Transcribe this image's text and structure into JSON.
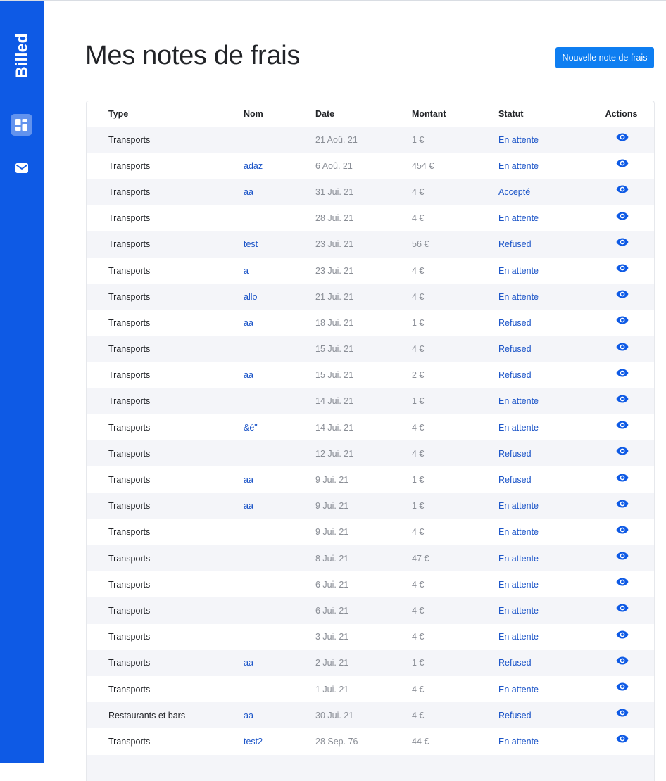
{
  "app": {
    "logo": "Billed"
  },
  "header": {
    "title": "Mes notes de frais",
    "new_button": "Nouvelle note de frais"
  },
  "colors": {
    "sidebar": "#0e5ae5",
    "button": "#0e7ef1",
    "link": "#1c55c8"
  },
  "table": {
    "columns": [
      "Type",
      "Nom",
      "Date",
      "Montant",
      "Statut",
      "Actions"
    ],
    "rows": [
      {
        "type": "Transports",
        "nom": "",
        "date": "21 Aoû. 21",
        "amount": "1 €",
        "status": "En attente"
      },
      {
        "type": "Transports",
        "nom": "adaz",
        "date": "6 Aoû. 21",
        "amount": "454 €",
        "status": "En attente"
      },
      {
        "type": "Transports",
        "nom": "aa",
        "date": "31 Jui. 21",
        "amount": "4 €",
        "status": "Accepté"
      },
      {
        "type": "Transports",
        "nom": "",
        "date": "28 Jui. 21",
        "amount": "4 €",
        "status": "En attente"
      },
      {
        "type": "Transports",
        "nom": "test",
        "date": "23 Jui. 21",
        "amount": "56 €",
        "status": "Refused"
      },
      {
        "type": "Transports",
        "nom": "a",
        "date": "23 Jui. 21",
        "amount": "4 €",
        "status": "En attente"
      },
      {
        "type": "Transports",
        "nom": "allo",
        "date": "21 Jui. 21",
        "amount": "4 €",
        "status": "En attente"
      },
      {
        "type": "Transports",
        "nom": "aa",
        "date": "18 Jui. 21",
        "amount": "1 €",
        "status": "Refused"
      },
      {
        "type": "Transports",
        "nom": "",
        "date": "15 Jui. 21",
        "amount": "4 €",
        "status": "Refused"
      },
      {
        "type": "Transports",
        "nom": "aa",
        "date": "15 Jui. 21",
        "amount": "2 €",
        "status": "Refused"
      },
      {
        "type": "Transports",
        "nom": "",
        "date": "14 Jui. 21",
        "amount": "1 €",
        "status": "En attente"
      },
      {
        "type": "Transports",
        "nom": "&é\"",
        "date": "14 Jui. 21",
        "amount": "4 €",
        "status": "En attente"
      },
      {
        "type": "Transports",
        "nom": "",
        "date": "12 Jui. 21",
        "amount": "4 €",
        "status": "Refused"
      },
      {
        "type": "Transports",
        "nom": "aa",
        "date": "9 Jui. 21",
        "amount": "1 €",
        "status": "Refused"
      },
      {
        "type": "Transports",
        "nom": "aa",
        "date": "9 Jui. 21",
        "amount": "1 €",
        "status": "En attente"
      },
      {
        "type": "Transports",
        "nom": "",
        "date": "9 Jui. 21",
        "amount": "4 €",
        "status": "En attente"
      },
      {
        "type": "Transports",
        "nom": "",
        "date": "8 Jui. 21",
        "amount": "47 €",
        "status": "En attente"
      },
      {
        "type": "Transports",
        "nom": "",
        "date": "6 Jui. 21",
        "amount": "4 €",
        "status": "En attente"
      },
      {
        "type": "Transports",
        "nom": "",
        "date": "6 Jui. 21",
        "amount": "4 €",
        "status": "En attente"
      },
      {
        "type": "Transports",
        "nom": "",
        "date": "3 Jui. 21",
        "amount": "4 €",
        "status": "En attente"
      },
      {
        "type": "Transports",
        "nom": "aa",
        "date": "2 Jui. 21",
        "amount": "1 €",
        "status": "Refused"
      },
      {
        "type": "Transports",
        "nom": "",
        "date": "1 Jui. 21",
        "amount": "4 €",
        "status": "En attente"
      },
      {
        "type": "Restaurants et bars",
        "nom": "aa",
        "date": "30 Jui. 21",
        "amount": "4 €",
        "status": "Refused"
      },
      {
        "type": "Transports",
        "nom": "test2",
        "date": "28 Sep. 76",
        "amount": "44 €",
        "status": "En attente"
      },
      {
        "type": "",
        "nom": "",
        "date": "",
        "amount": "",
        "status": ""
      }
    ]
  }
}
